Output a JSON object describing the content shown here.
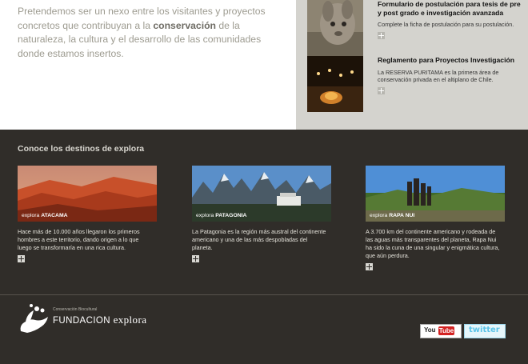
{
  "intro": {
    "before": "Pretendemos ser un nexo entre los visitantes y proyectos concretos que contribuyan a la ",
    "bold": "conservación",
    "after": " de la naturaleza, la cultura y el desarrollo de las comunidades donde estamos insertos."
  },
  "sidebar": {
    "items": [
      {
        "title": "Formulario de postulación para tesis de pre y post grado e investigación avanzada",
        "description": "Complete la ficha de postulación para su postulación."
      },
      {
        "title": "Reglamento para Proyectos Investigación",
        "description": "La RESERVA PURITAMA es la primera área de conservación privada en el altiplano de Chile."
      }
    ]
  },
  "destinations": {
    "title": "Conoce los destinos de explora",
    "items": [
      {
        "label_prefix": "explora ",
        "label_name": "ATACAMA",
        "description": "Hace más de 10.000 años llegaron los primeros hombres a este territorio, dando origen a lo que luego se transformaría en una rica cultura."
      },
      {
        "label_prefix": "explora ",
        "label_name": "PATAGONIA",
        "description": "La Patagonia es la región más austral del continente americano y una de las más despobladas del planeta."
      },
      {
        "label_prefix": "explora ",
        "label_name": "RAPA NUI",
        "description": "A 3.700 km del continente americano y rodeada de las aguas más transparentes del planeta, Rapa Nui ha sido la cuna de una singular y enigmática cultura, que aún perdura."
      }
    ]
  },
  "footer": {
    "logo_small": "Conservación Biocultural",
    "logo_main": "FUNDACION",
    "logo_brand": "explora",
    "youtube_you": "You",
    "youtube_tube": "Tube",
    "twitter": "twitter"
  },
  "colors": {
    "dark_bg": "#302d29",
    "sidebar_bg": "#d4d3ce",
    "intro_text": "#9d9b90"
  }
}
